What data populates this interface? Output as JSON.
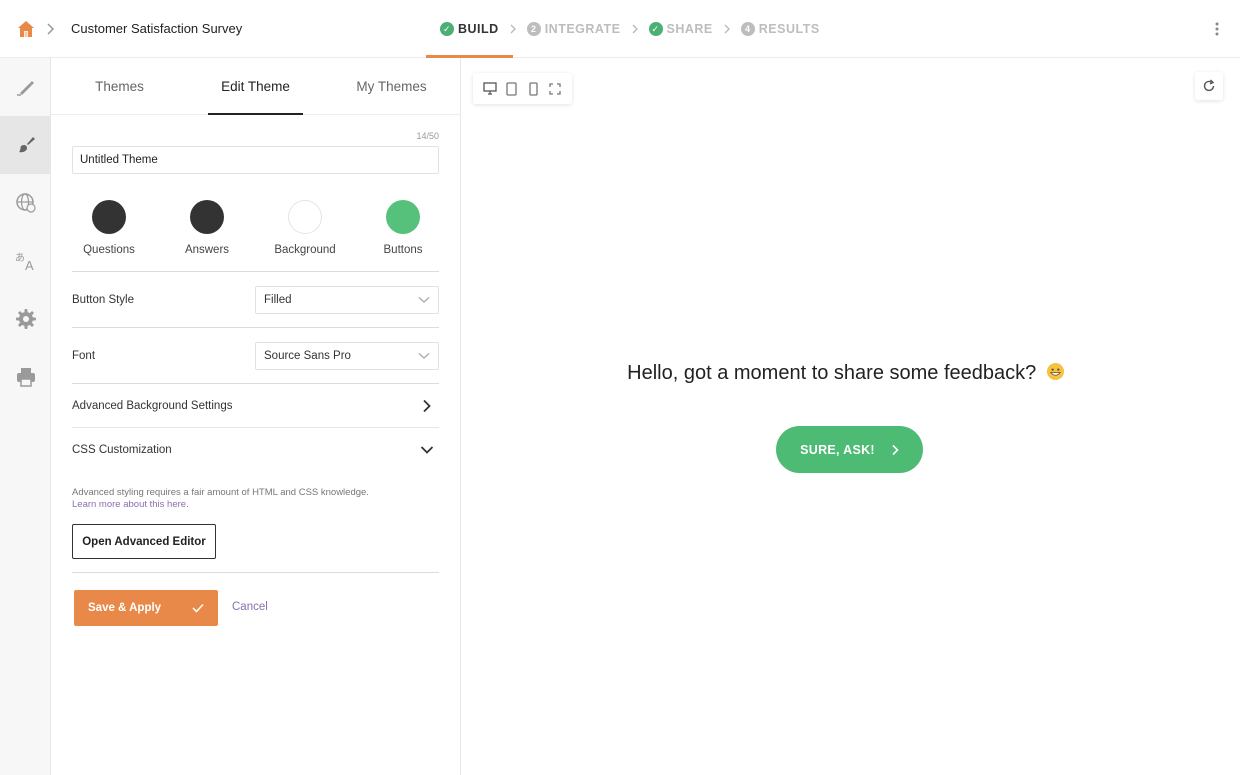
{
  "header": {
    "survey_title": "Customer Satisfaction Survey",
    "steps": [
      {
        "label": "BUILD",
        "status": "done",
        "marker": "check",
        "active": true
      },
      {
        "label": "INTEGRATE",
        "status": "todo",
        "marker": "2",
        "active": false
      },
      {
        "label": "SHARE",
        "status": "done",
        "marker": "check",
        "active": false
      },
      {
        "label": "RESULTS",
        "status": "todo",
        "marker": "4",
        "active": false
      }
    ],
    "menu_icon": "kebab-icon"
  },
  "rail": {
    "items": [
      {
        "icon": "pen-icon"
      },
      {
        "icon": "paintbrush-icon",
        "active": true
      },
      {
        "icon": "globe-icon"
      },
      {
        "icon": "translate-icon"
      },
      {
        "icon": "gear-icon"
      },
      {
        "icon": "printer-icon"
      }
    ]
  },
  "panel": {
    "tabs": [
      {
        "label": "Themes"
      },
      {
        "label": "Edit Theme",
        "active": true
      },
      {
        "label": "My Themes"
      }
    ],
    "theme_name": {
      "value": "Untitled Theme",
      "counter": "14/50"
    },
    "colors": [
      {
        "label": "Questions",
        "hex": "#333333"
      },
      {
        "label": "Answers",
        "hex": "#333333"
      },
      {
        "label": "Background",
        "hex": "#ffffff"
      },
      {
        "label": "Buttons",
        "hex": "#55c17a"
      }
    ],
    "button_style": {
      "label": "Button Style",
      "value": "Filled"
    },
    "font": {
      "label": "Font",
      "value": "Source Sans Pro"
    },
    "advanced_background": {
      "label": "Advanced Background Settings"
    },
    "css": {
      "label": "CSS Customization",
      "help": "Advanced styling requires a fair amount of HTML and CSS knowledge.",
      "link": "Learn more about this here.",
      "button": "Open Advanced Editor"
    },
    "save_label": "Save & Apply",
    "cancel_label": "Cancel"
  },
  "preview": {
    "devices": [
      "desktop-icon",
      "tablet-icon",
      "mobile-icon",
      "fullscreen-icon"
    ],
    "question": "Hello, got a moment to share some feedback?",
    "cta_label": "SURE, ASK!"
  },
  "colors": {
    "accent": "#e8894a",
    "success": "#4caf73",
    "cta": "#4dbb73",
    "link": "#8a6fb0"
  }
}
